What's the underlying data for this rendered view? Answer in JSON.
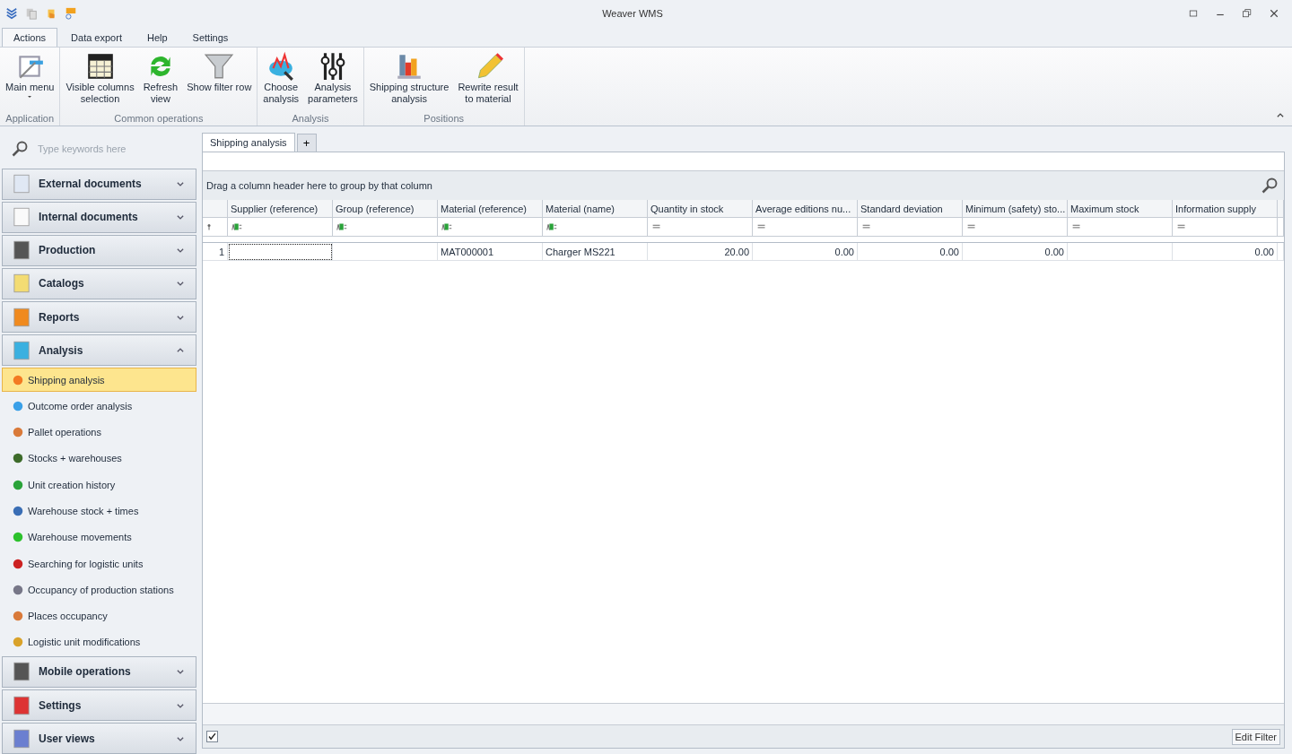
{
  "window": {
    "title": "Weaver WMS"
  },
  "ribbon_tabs": [
    {
      "label": "Actions",
      "selected": true
    },
    {
      "label": "Data export",
      "selected": false
    },
    {
      "label": "Help",
      "selected": false
    },
    {
      "label": "Settings",
      "selected": false
    }
  ],
  "ribbon_groups": [
    {
      "label": "Application",
      "buttons": [
        {
          "lines": [
            "Main menu"
          ],
          "dropdown": true
        }
      ]
    },
    {
      "label": "Common operations",
      "buttons": [
        {
          "lines": [
            "Visible columns",
            "selection"
          ]
        },
        {
          "lines": [
            "Refresh",
            "view"
          ]
        },
        {
          "lines": [
            "Show filter row"
          ]
        }
      ]
    },
    {
      "label": "Analysis",
      "buttons": [
        {
          "lines": [
            "Choose",
            "analysis"
          ]
        },
        {
          "lines": [
            "Analysis",
            "parameters"
          ]
        }
      ]
    },
    {
      "label": "Positions",
      "buttons": [
        {
          "lines": [
            "Shipping structure",
            "analysis"
          ]
        },
        {
          "lines": [
            "Rewrite result",
            "to material"
          ]
        }
      ]
    }
  ],
  "sidebar": {
    "search": {
      "placeholder": "Type keywords here"
    },
    "groups": [
      {
        "label": "External documents",
        "expanded": false
      },
      {
        "label": "Internal documents",
        "expanded": false
      },
      {
        "label": "Production",
        "expanded": false
      },
      {
        "label": "Catalogs",
        "expanded": false
      },
      {
        "label": "Reports",
        "expanded": false
      },
      {
        "label": "Analysis",
        "expanded": true,
        "items": [
          {
            "label": "Shipping analysis",
            "selected": true
          },
          {
            "label": "Outcome order analysis",
            "selected": false
          },
          {
            "label": "Pallet operations",
            "selected": false
          },
          {
            "label": "Stocks + warehouses",
            "selected": false
          },
          {
            "label": "Unit creation history",
            "selected": false
          },
          {
            "label": "Warehouse stock + times",
            "selected": false
          },
          {
            "label": "Warehouse movements",
            "selected": false
          },
          {
            "label": "Searching for logistic units",
            "selected": false
          },
          {
            "label": "Occupancy of production stations",
            "selected": false
          },
          {
            "label": "Places occupancy",
            "selected": false
          },
          {
            "label": "Logistic unit modifications",
            "selected": false
          }
        ]
      },
      {
        "label": "Mobile operations",
        "expanded": false
      },
      {
        "label": "Settings",
        "expanded": false
      },
      {
        "label": "User views",
        "expanded": false
      }
    ]
  },
  "document_tabs": [
    {
      "label": "Shipping analysis",
      "selected": true
    }
  ],
  "add_tab": "+",
  "grid": {
    "group_panel": "Drag a column header here to group by that column",
    "columns": [
      {
        "label": "Supplier (reference)",
        "kind": "text"
      },
      {
        "label": "Group (reference)",
        "kind": "text"
      },
      {
        "label": "Material (reference)",
        "kind": "text"
      },
      {
        "label": "Material (name)",
        "kind": "text"
      },
      {
        "label": "Quantity in stock",
        "kind": "number"
      },
      {
        "label": "Average editions nu...",
        "kind": "number"
      },
      {
        "label": "Standard deviation",
        "kind": "number"
      },
      {
        "label": "Minimum (safety) sto...",
        "kind": "number"
      },
      {
        "label": "Maximum stock",
        "kind": "number"
      },
      {
        "label": "Information supply",
        "kind": "number"
      }
    ],
    "rows": [
      {
        "number": "1",
        "cells": [
          {
            "focused": true
          },
          {},
          {
            "value": "MAT000001"
          },
          {
            "value": "Charger MS221"
          },
          {
            "value": "20.00"
          },
          {
            "value": "0.00"
          },
          {
            "value": "0.00"
          },
          {
            "value": "0.00"
          },
          {},
          {
            "value": "0.00"
          }
        ]
      }
    ]
  },
  "footer": {
    "filter_enabled": true,
    "edit_filter": "Edit Filter"
  }
}
